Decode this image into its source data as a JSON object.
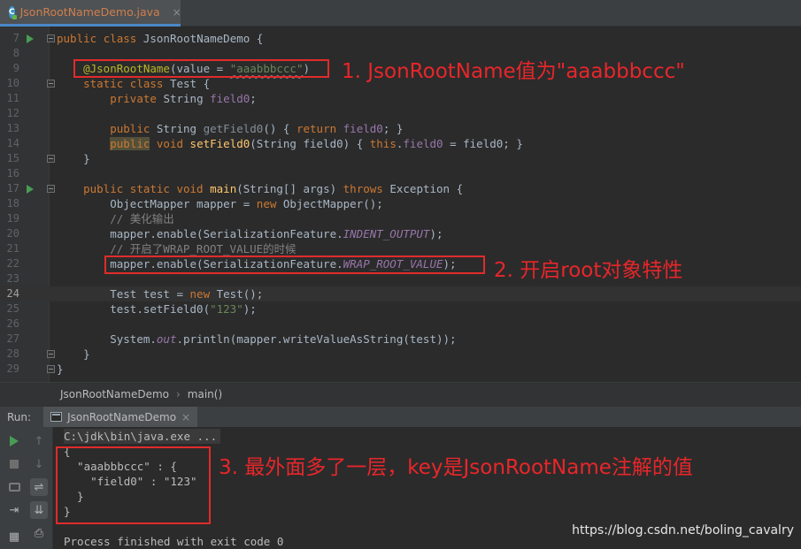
{
  "tab": {
    "label": "JsonRootNameDemo.java",
    "close": "×",
    "icon": "java-class-icon"
  },
  "code": {
    "lines": [
      {
        "n": "7"
      },
      {
        "n": "8"
      },
      {
        "n": "9"
      },
      {
        "n": "10"
      },
      {
        "n": "11"
      },
      {
        "n": "12"
      },
      {
        "n": "13"
      },
      {
        "n": "14"
      },
      {
        "n": "15"
      },
      {
        "n": "16"
      },
      {
        "n": "17"
      },
      {
        "n": "18"
      },
      {
        "n": "19"
      },
      {
        "n": "20"
      },
      {
        "n": "21"
      },
      {
        "n": "22"
      },
      {
        "n": "23"
      },
      {
        "n": "24"
      },
      {
        "n": "25"
      },
      {
        "n": "26"
      },
      {
        "n": "27"
      },
      {
        "n": "28"
      },
      {
        "n": "29"
      }
    ],
    "t": {
      "public": "public",
      "class": "class",
      "static": "static",
      "private": "private",
      "void": "void",
      "return": "return",
      "this": "this",
      "new": "new",
      "throws": "throws",
      "class_name": "JsonRootNameDemo",
      "brace_open": " {",
      "brace_close": "}",
      "annotation": "@JsonRootName",
      "ann_open": "(value = ",
      "ann_value": "\"aaabbbccc\"",
      "ann_close": ")",
      "test_class": "Test",
      "string_type": "String",
      "field0": "field0",
      "semicolon": ";",
      "getter_name": "getField0",
      "getter_params": "() { ",
      "getter_end": "; }",
      "setter_name": "setField0",
      "setter_params": "(String field0) { ",
      "setter_dot": ".",
      "setter_assign": " = field0; }",
      "main_name": "main",
      "main_params": "(String[] args) ",
      "exception": " Exception {",
      "mapper_decl": "ObjectMapper mapper = ",
      "mapper_ctor": " ObjectMapper();",
      "comment1": "// 美化输出",
      "enable_open": "mapper.enable(SerializationFeature.",
      "indent_output": "INDENT_OUTPUT",
      "enable_close": ");",
      "comment2": "// 开启了WRAP_ROOT_VALUE的时候",
      "wrap_root_value": "WRAP_ROOT_VALUE",
      "test_decl": "Test test = ",
      "test_ctor": " Test();",
      "set_call": "test.setField0(",
      "set_value": "\"123\"",
      "set_close": ");",
      "println_open": "System.",
      "out": "out",
      "println_rest": ".println(mapper.writeValueAsString(test));"
    }
  },
  "annotations": {
    "a1": "1. JsonRootName值为\"aaabbbccc\"",
    "a2": "2. 开启root对象特性",
    "a3": "3. 最外面多了一层，key是JsonRootName注解的值"
  },
  "breadcrumb": {
    "items": [
      "JsonRootNameDemo",
      "main()"
    ],
    "separator": "›"
  },
  "run": {
    "title": "Run:",
    "tab_label": "JsonRootNameDemo",
    "tab_close": "×",
    "console": [
      "C:\\jdk\\bin\\java.exe ...",
      "{",
      "  \"aaabbbccc\" : {",
      "    \"field0\" : \"123\"",
      "  }",
      "}",
      "",
      "Process finished with exit code 0"
    ]
  },
  "icons": {
    "up": "↑",
    "down": "↓",
    "wrap": "⇌",
    "scroll": "⇊",
    "print": "⎙",
    "login": "⇥",
    "layout": "▦"
  },
  "watermark": "https://blog.csdn.net/boling_cavalry",
  "colors": {
    "keyword": "#cc7832",
    "annotation": "#bbb529",
    "string": "#6a8759",
    "field": "#9876aa",
    "method": "#ffc66d",
    "highlight_box": "#e12b2b"
  }
}
